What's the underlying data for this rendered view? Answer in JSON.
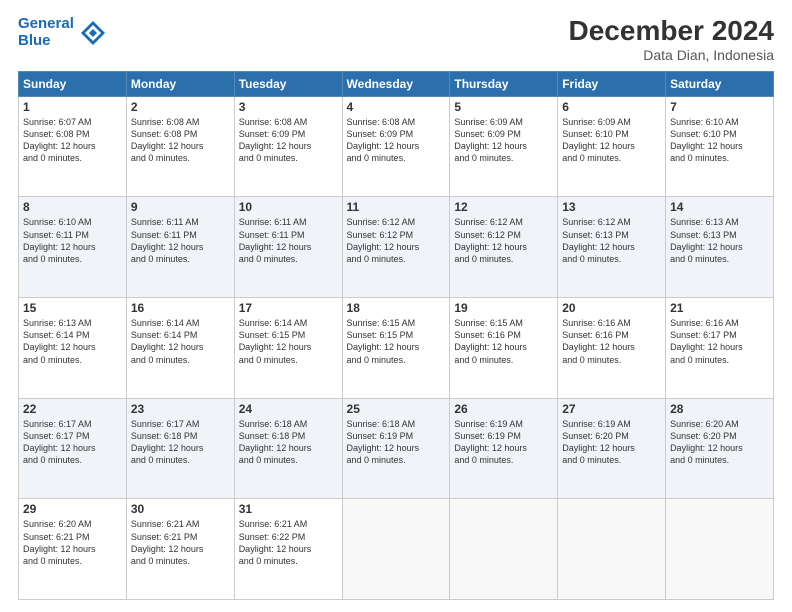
{
  "logo": {
    "line1": "General",
    "line2": "Blue"
  },
  "title": "December 2024",
  "subtitle": "Data Dian, Indonesia",
  "days_header": [
    "Sunday",
    "Monday",
    "Tuesday",
    "Wednesday",
    "Thursday",
    "Friday",
    "Saturday"
  ],
  "weeks": [
    [
      {
        "day": "1",
        "sunrise": "6:07 AM",
        "sunset": "6:08 PM",
        "daylight": "12 hours and 0 minutes."
      },
      {
        "day": "2",
        "sunrise": "6:08 AM",
        "sunset": "6:08 PM",
        "daylight": "12 hours and 0 minutes."
      },
      {
        "day": "3",
        "sunrise": "6:08 AM",
        "sunset": "6:09 PM",
        "daylight": "12 hours and 0 minutes."
      },
      {
        "day": "4",
        "sunrise": "6:08 AM",
        "sunset": "6:09 PM",
        "daylight": "12 hours and 0 minutes."
      },
      {
        "day": "5",
        "sunrise": "6:09 AM",
        "sunset": "6:09 PM",
        "daylight": "12 hours and 0 minutes."
      },
      {
        "day": "6",
        "sunrise": "6:09 AM",
        "sunset": "6:10 PM",
        "daylight": "12 hours and 0 minutes."
      },
      {
        "day": "7",
        "sunrise": "6:10 AM",
        "sunset": "6:10 PM",
        "daylight": "12 hours and 0 minutes."
      }
    ],
    [
      {
        "day": "8",
        "sunrise": "6:10 AM",
        "sunset": "6:11 PM",
        "daylight": "12 hours and 0 minutes."
      },
      {
        "day": "9",
        "sunrise": "6:11 AM",
        "sunset": "6:11 PM",
        "daylight": "12 hours and 0 minutes."
      },
      {
        "day": "10",
        "sunrise": "6:11 AM",
        "sunset": "6:11 PM",
        "daylight": "12 hours and 0 minutes."
      },
      {
        "day": "11",
        "sunrise": "6:12 AM",
        "sunset": "6:12 PM",
        "daylight": "12 hours and 0 minutes."
      },
      {
        "day": "12",
        "sunrise": "6:12 AM",
        "sunset": "6:12 PM",
        "daylight": "12 hours and 0 minutes."
      },
      {
        "day": "13",
        "sunrise": "6:12 AM",
        "sunset": "6:13 PM",
        "daylight": "12 hours and 0 minutes."
      },
      {
        "day": "14",
        "sunrise": "6:13 AM",
        "sunset": "6:13 PM",
        "daylight": "12 hours and 0 minutes."
      }
    ],
    [
      {
        "day": "15",
        "sunrise": "6:13 AM",
        "sunset": "6:14 PM",
        "daylight": "12 hours and 0 minutes."
      },
      {
        "day": "16",
        "sunrise": "6:14 AM",
        "sunset": "6:14 PM",
        "daylight": "12 hours and 0 minutes."
      },
      {
        "day": "17",
        "sunrise": "6:14 AM",
        "sunset": "6:15 PM",
        "daylight": "12 hours and 0 minutes."
      },
      {
        "day": "18",
        "sunrise": "6:15 AM",
        "sunset": "6:15 PM",
        "daylight": "12 hours and 0 minutes."
      },
      {
        "day": "19",
        "sunrise": "6:15 AM",
        "sunset": "6:16 PM",
        "daylight": "12 hours and 0 minutes."
      },
      {
        "day": "20",
        "sunrise": "6:16 AM",
        "sunset": "6:16 PM",
        "daylight": "12 hours and 0 minutes."
      },
      {
        "day": "21",
        "sunrise": "6:16 AM",
        "sunset": "6:17 PM",
        "daylight": "12 hours and 0 minutes."
      }
    ],
    [
      {
        "day": "22",
        "sunrise": "6:17 AM",
        "sunset": "6:17 PM",
        "daylight": "12 hours and 0 minutes."
      },
      {
        "day": "23",
        "sunrise": "6:17 AM",
        "sunset": "6:18 PM",
        "daylight": "12 hours and 0 minutes."
      },
      {
        "day": "24",
        "sunrise": "6:18 AM",
        "sunset": "6:18 PM",
        "daylight": "12 hours and 0 minutes."
      },
      {
        "day": "25",
        "sunrise": "6:18 AM",
        "sunset": "6:19 PM",
        "daylight": "12 hours and 0 minutes."
      },
      {
        "day": "26",
        "sunrise": "6:19 AM",
        "sunset": "6:19 PM",
        "daylight": "12 hours and 0 minutes."
      },
      {
        "day": "27",
        "sunrise": "6:19 AM",
        "sunset": "6:20 PM",
        "daylight": "12 hours and 0 minutes."
      },
      {
        "day": "28",
        "sunrise": "6:20 AM",
        "sunset": "6:20 PM",
        "daylight": "12 hours and 0 minutes."
      }
    ],
    [
      {
        "day": "29",
        "sunrise": "6:20 AM",
        "sunset": "6:21 PM",
        "daylight": "12 hours and 0 minutes."
      },
      {
        "day": "30",
        "sunrise": "6:21 AM",
        "sunset": "6:21 PM",
        "daylight": "12 hours and 0 minutes."
      },
      {
        "day": "31",
        "sunrise": "6:21 AM",
        "sunset": "6:22 PM",
        "daylight": "12 hours and 0 minutes."
      },
      null,
      null,
      null,
      null
    ]
  ],
  "labels": {
    "sunrise": "Sunrise:",
    "sunset": "Sunset:",
    "daylight": "Daylight:"
  }
}
